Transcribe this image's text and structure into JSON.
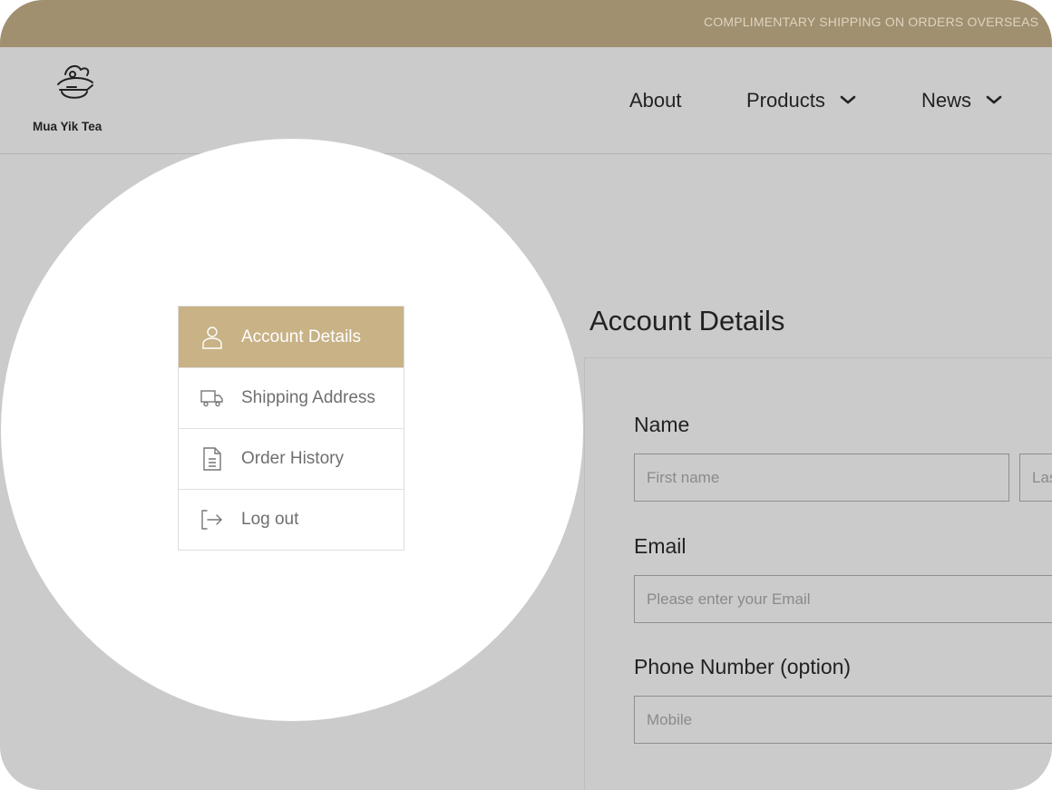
{
  "promo": {
    "text": "COMPLIMENTARY SHIPPING ON ORDERS OVERSEAS"
  },
  "brand": {
    "name": "Mua Yik Tea",
    "icon": "teapot-logo-icon"
  },
  "nav": {
    "about": "About",
    "products": "Products",
    "news": "News"
  },
  "sidebar": {
    "items": [
      {
        "label": "Account Details",
        "icon": "user-icon",
        "active": true
      },
      {
        "label": "Shipping Address",
        "icon": "truck-icon",
        "active": false
      },
      {
        "label": "Order History",
        "icon": "document-icon",
        "active": false
      },
      {
        "label": "Log out",
        "icon": "logout-icon",
        "active": false
      }
    ]
  },
  "account": {
    "title": "Account Details",
    "name_label": "Name",
    "first_name_placeholder": "First name",
    "last_name_placeholder": "Last name",
    "email_label": "Email",
    "email_placeholder": "Please enter your Email",
    "phone_label": "Phone Number (option)",
    "phone_placeholder": "Mobile"
  },
  "colors": {
    "promo_bar": "#a0906f",
    "accent": "#c8b286",
    "background": "#cbcbcb"
  }
}
